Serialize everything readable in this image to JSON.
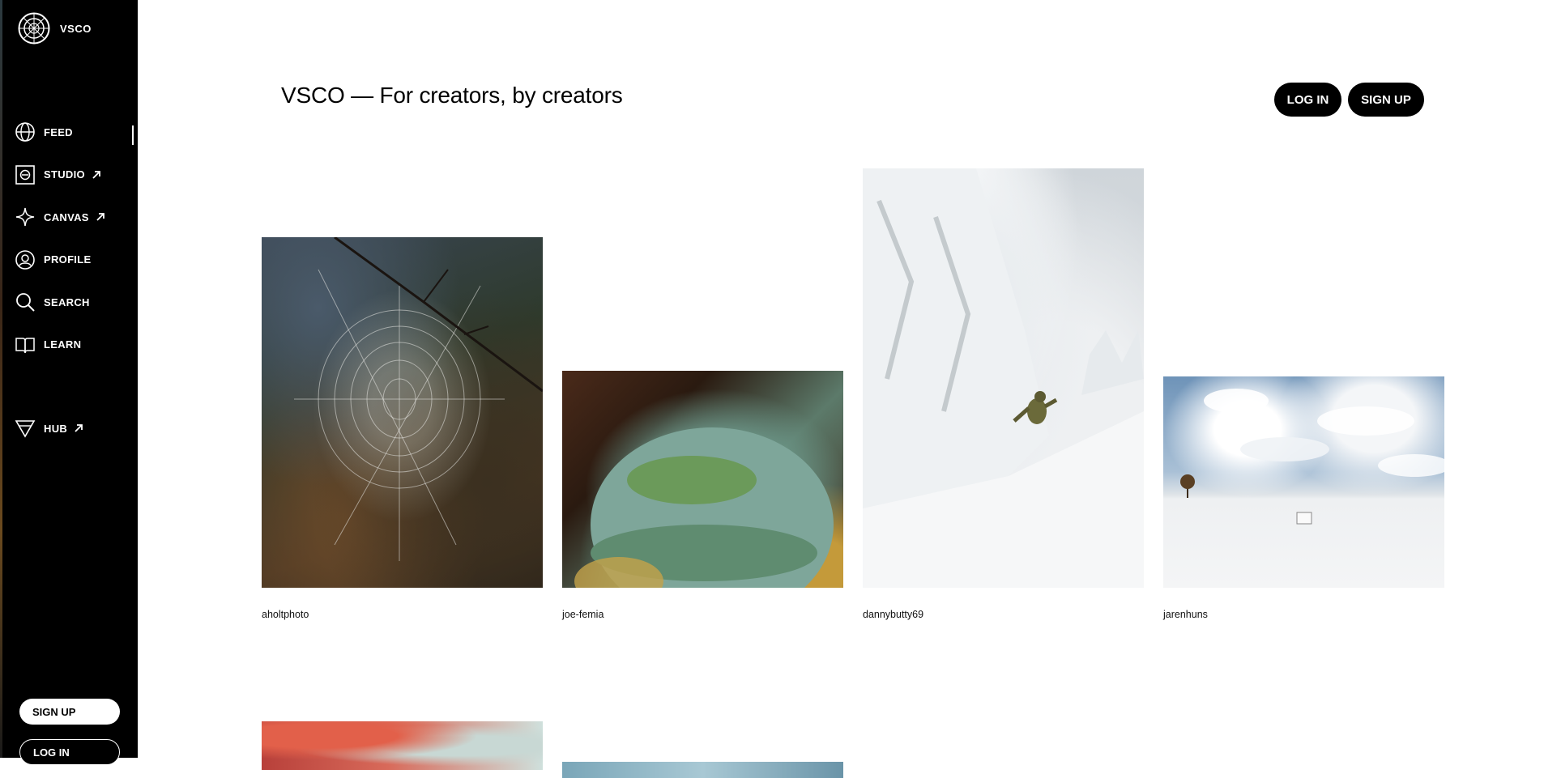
{
  "brand": {
    "name": "VSCO"
  },
  "sidebar": {
    "items": [
      {
        "label": "FEED",
        "icon": "globe-icon",
        "external": false,
        "active": true
      },
      {
        "label": "STUDIO",
        "icon": "studio-icon",
        "external": true
      },
      {
        "label": "CANVAS",
        "icon": "sparkle-icon",
        "external": true
      },
      {
        "label": "PROFILE",
        "icon": "profile-icon",
        "external": false
      },
      {
        "label": "SEARCH",
        "icon": "search-icon",
        "external": false
      },
      {
        "label": "LEARN",
        "icon": "book-icon",
        "external": false
      }
    ],
    "hub": {
      "label": "HUB",
      "icon": "hub-icon",
      "external": true
    },
    "signup_label": "SIGN UP",
    "login_label": "LOG IN"
  },
  "header": {
    "title": "VSCO — For creators, by creators",
    "login_label": "LOG IN",
    "signup_label": "SIGN UP"
  },
  "feed": {
    "photos": [
      {
        "username": "aholtphoto"
      },
      {
        "username": "joe-femia"
      },
      {
        "username": "dannybutty69"
      },
      {
        "username": "jarenhuns"
      }
    ]
  }
}
